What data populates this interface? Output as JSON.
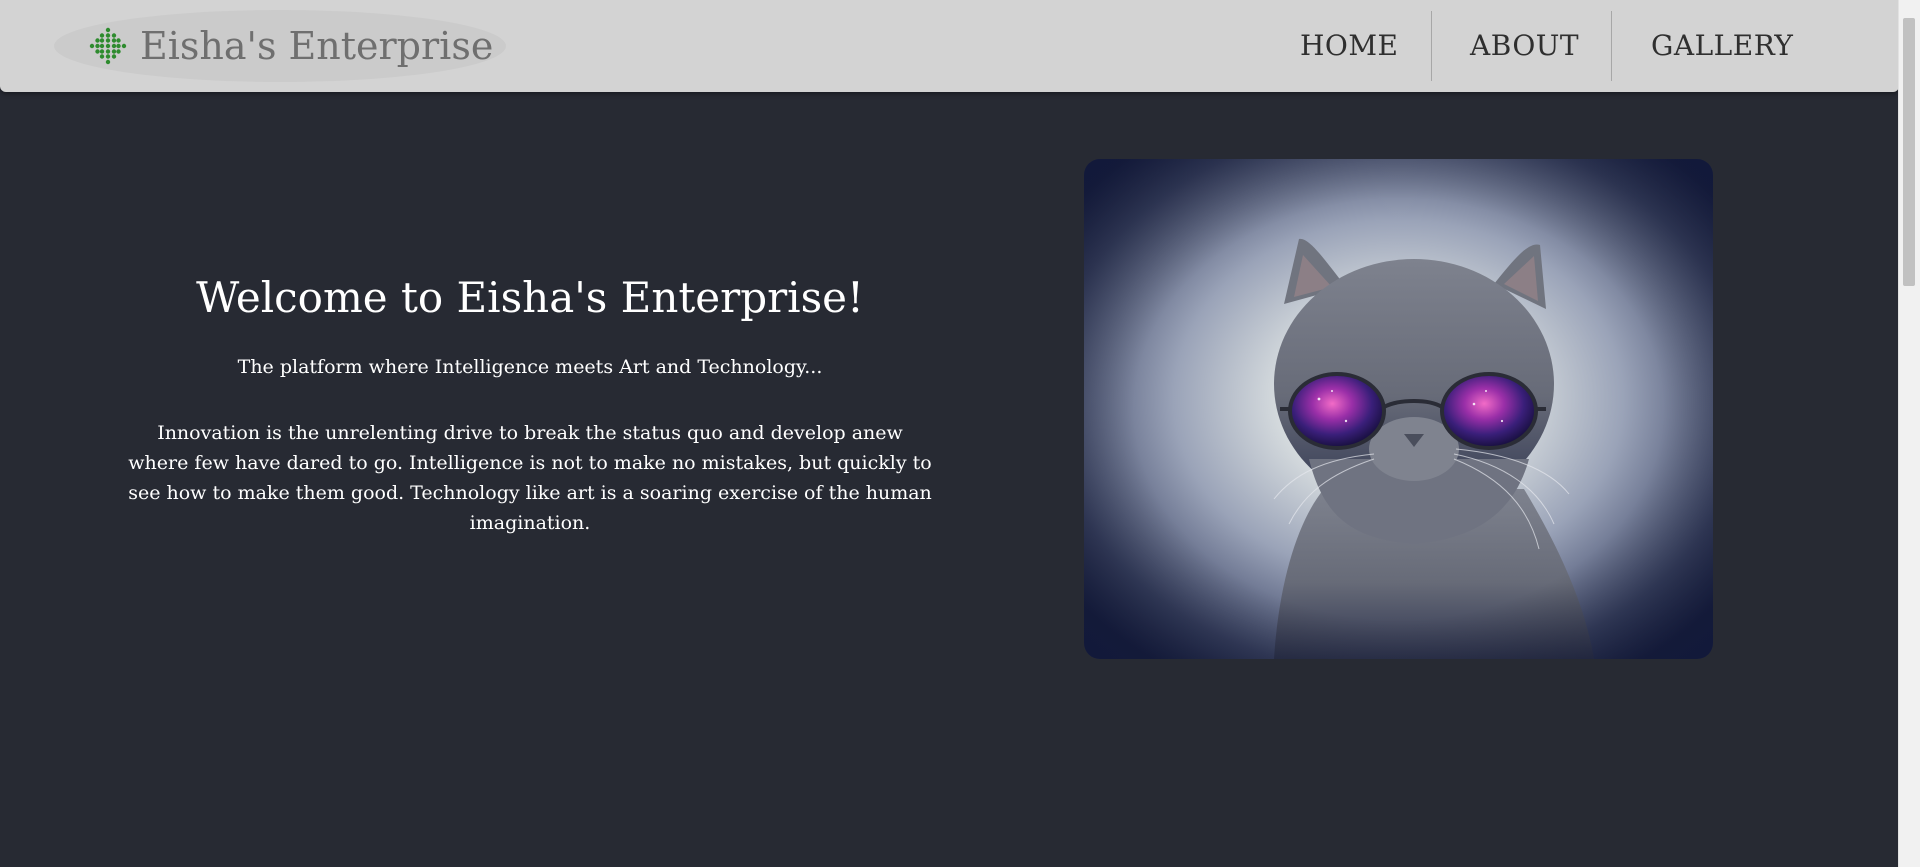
{
  "brand": {
    "name": "Eisha's Enterprise",
    "icon": "dotted-plus-logo-icon",
    "icon_color": "#2e8b2e"
  },
  "nav": {
    "items": [
      {
        "label": "HOME"
      },
      {
        "label": "ABOUT"
      },
      {
        "label": "GALLERY"
      }
    ]
  },
  "hero": {
    "title": "Welcome to Eisha's Enterprise!",
    "tagline": "The platform where Intelligence meets Art and Technology...",
    "body": "Innovation is the unrelenting drive to break the status quo and develop anew where few have dared to go. Intelligence is not to make no mistakes, but quickly to see how to make them good. Technology like art is a soaring exercise of the human imagination."
  },
  "image": {
    "subject": "gray cat wearing galaxy sunglasses"
  },
  "colors": {
    "background": "#272a33",
    "navbar": "#d3d3d3",
    "text": "#ffffff",
    "brand_text": "#6f6f6f",
    "nav_text": "#2f2f2f"
  }
}
